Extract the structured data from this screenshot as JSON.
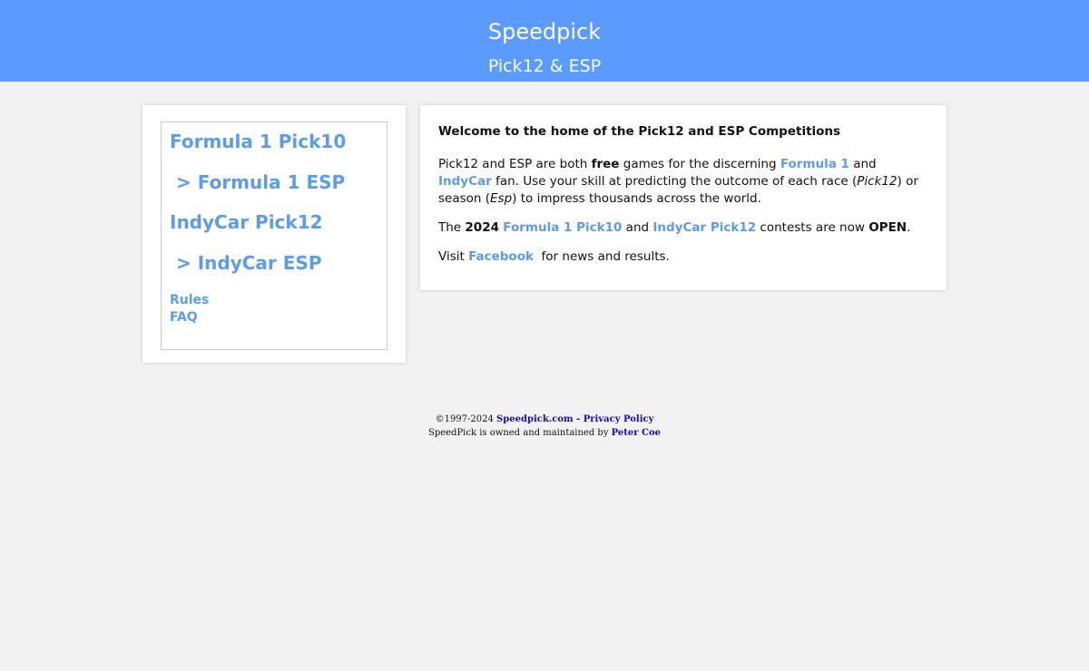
{
  "header": {
    "title": "Speedpick",
    "subtitle": "Pick12 & ESP"
  },
  "nav": {
    "items": [
      {
        "label": "Formula 1 Pick10"
      },
      {
        "label": "> Formula 1 ESP"
      },
      {
        "label": "IndyCar Pick12"
      },
      {
        "label": "> IndyCar ESP"
      },
      {
        "label": "Rules"
      },
      {
        "label": "FAQ"
      }
    ]
  },
  "main": {
    "welcome": "Welcome to the home of the Pick12 and ESP Competitions",
    "p1": {
      "t1": "Pick12 and ESP are both ",
      "free": "free",
      "t2": " games for the discerning ",
      "link_f1": "Formula 1",
      "t3": " and ",
      "link_indycar": "IndyCar",
      "t4": " fan. Use your skill at predicting the outcome of each race (",
      "em_pick12": "Pick12",
      "t5": ") or season (",
      "em_esp": "Esp",
      "t6": ") to impress thousands across the world."
    },
    "p2": {
      "t1": "The ",
      "year": "2024",
      "t2": " ",
      "link_f1_pick10": "Formula 1 Pick10",
      "t3": " and ",
      "link_indycar_pick12": "IndyCar Pick12",
      "t4": " contests are now ",
      "open": "OPEN",
      "t5": "."
    },
    "p3": {
      "t1": "Visit ",
      "link_facebook": "Facebook",
      "t2": "  for news and results."
    }
  },
  "footer": {
    "copyright": "©1997-2024 ",
    "link_site": "Speedpick.com",
    "sep": " - ",
    "link_privacy": "Privacy Policy",
    "owned": "SpeedPick is owned and maintained by ",
    "link_owner": "Peter Coe"
  },
  "colors": {
    "header_bg": "#5b9bff",
    "link": "#5b9bf0",
    "footer_link": "#1010b8",
    "page_bg": "#f2f2f2"
  }
}
